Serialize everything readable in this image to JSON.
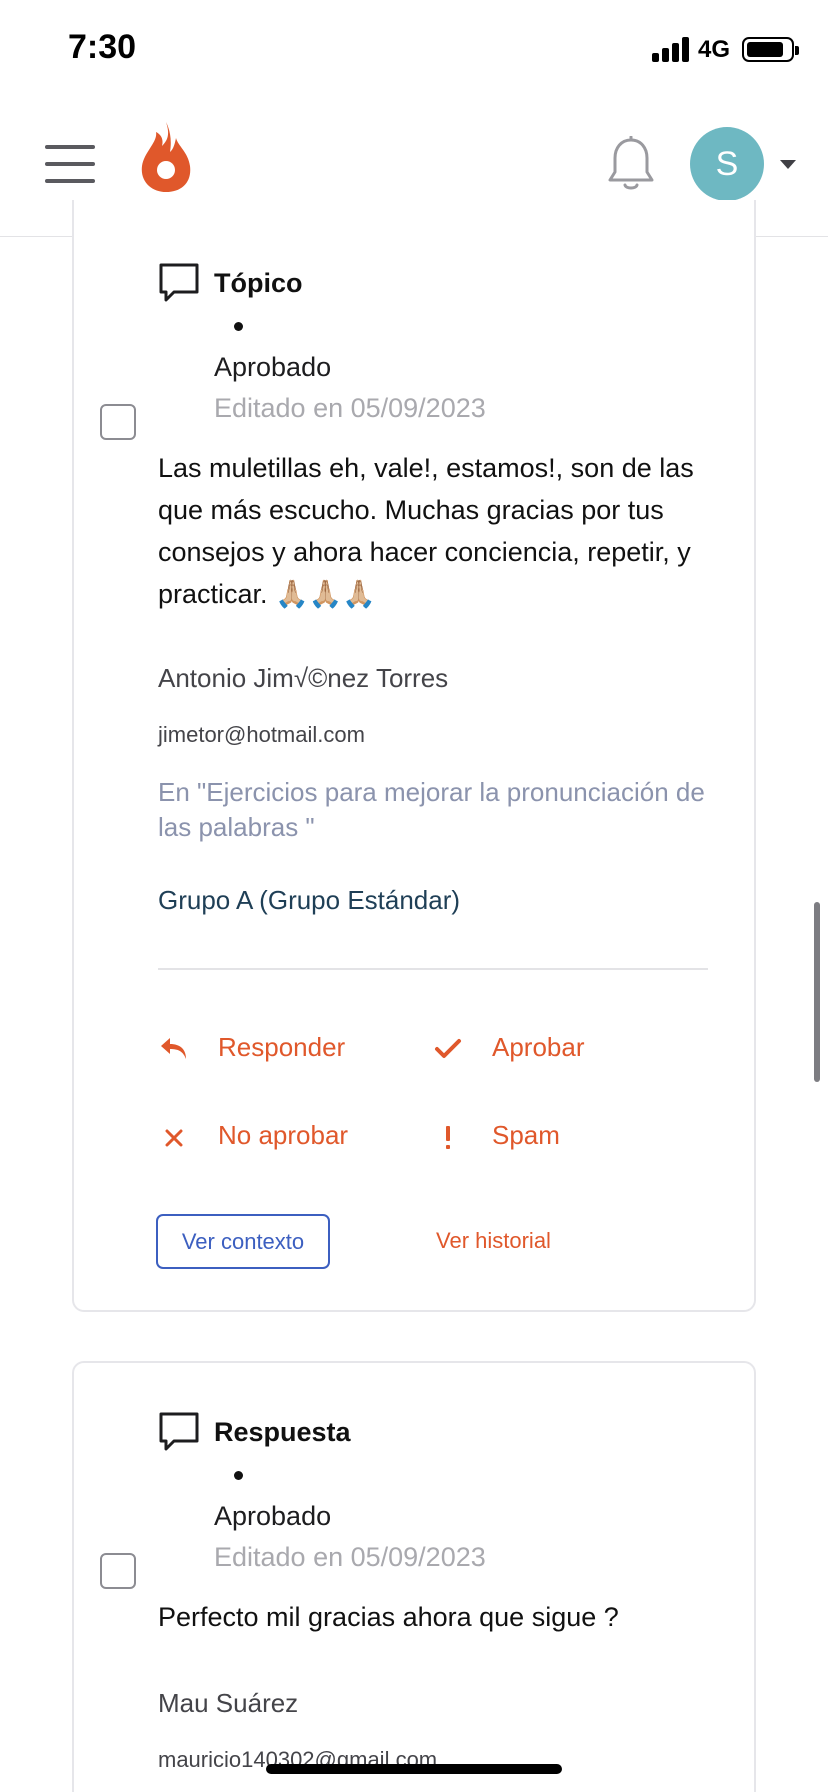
{
  "status_bar": {
    "time": "7:30",
    "network": "4G"
  },
  "header": {
    "avatar_initial": "S",
    "brand_color": "#e0582b"
  },
  "cards": [
    {
      "type_label": "Tópico",
      "status": "Aprobado",
      "edited": "Editado en 05/09/2023",
      "body": "Las muletillas eh, vale!, estamos!, son de las que más escucho. Muchas gracias por tus consejos y ahora hacer conciencia, repetir, y practicar. 🙏🏼🙏🏼🙏🏼",
      "author": "Antonio Jim√©nez Torres",
      "email": "jimetor@hotmail.com",
      "context": "En \"Ejercicios para mejorar la pronunciación de las palabras \"",
      "group": "Grupo A (Grupo Estándar)",
      "actions": {
        "reply": "Responder",
        "approve": "Aprobar",
        "disapprove": "No aprobar",
        "spam": "Spam"
      },
      "view_context": "Ver contexto",
      "view_history": "Ver historial"
    },
    {
      "type_label": "Respuesta",
      "status": "Aprobado",
      "edited": "Editado en 05/09/2023",
      "body": "Perfecto mil gracias ahora que sigue ?",
      "author": "Mau Suárez",
      "email": "mauricio140302@gmail.com"
    }
  ]
}
